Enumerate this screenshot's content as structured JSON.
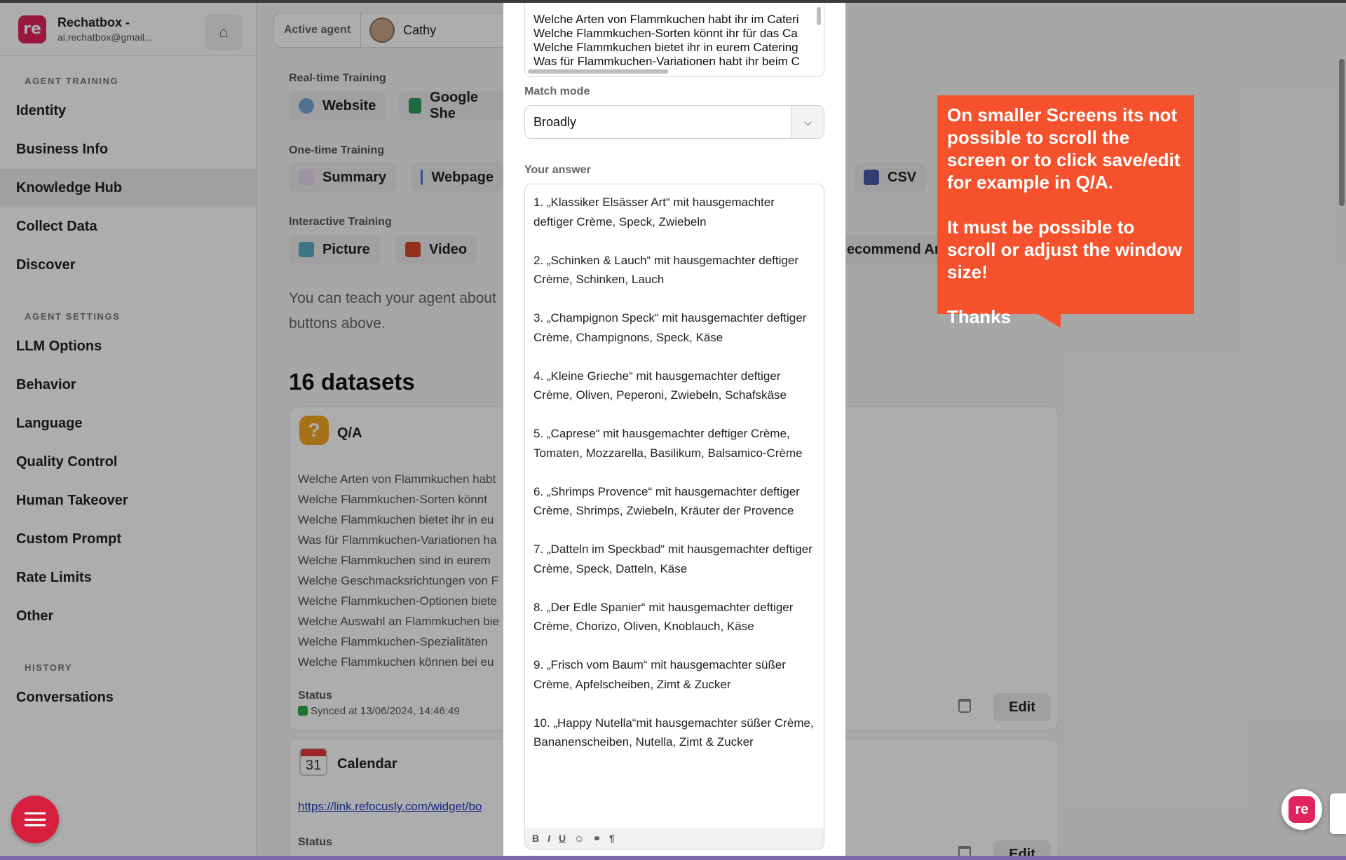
{
  "brand": {
    "name": "Rechatbox -",
    "email": "ai.rechatbox@gmail..."
  },
  "sidebar": {
    "sections": [
      {
        "title": "AGENT TRAINING",
        "items": [
          "Identity",
          "Business Info",
          "Knowledge Hub",
          "Collect Data",
          "Discover"
        ]
      },
      {
        "title": "AGENT SETTINGS",
        "items": [
          "LLM Options",
          "Behavior",
          "Language",
          "Quality Control",
          "Human Takeover",
          "Custom Prompt",
          "Rate Limits",
          "Other"
        ]
      },
      {
        "title": "HISTORY",
        "items": [
          "Conversations"
        ]
      }
    ],
    "active": "Knowledge Hub"
  },
  "header": {
    "active_agent_label": "Active agent",
    "agent_name": "Cathy"
  },
  "training": {
    "realtime_label": "Real-time Training",
    "realtime": [
      "Website",
      "Google She"
    ],
    "onetime_label": "One-time Training",
    "onetime": [
      "Summary",
      "Webpage",
      "CSV"
    ],
    "interactive_label": "Interactive Training",
    "interactive": [
      "Picture",
      "Video",
      "ecommend Art"
    ],
    "teach_text": "You can teach your agent about buttons above."
  },
  "datasets": {
    "count_label": "16 datasets",
    "qa": {
      "title": "Q/A",
      "questions": [
        "Welche Arten von Flammkuchen habt",
        "Welche Flammkuchen-Sorten könnt",
        "Welche Flammkuchen bietet ihr in eu",
        "Was für Flammkuchen-Variationen ha",
        "Welche Flammkuchen sind in eurem",
        "Welche Geschmacksrichtungen von F",
        "Welche Flammkuchen-Optionen biete",
        "Welche Auswahl an Flammkuchen bie",
        "Welche Flammkuchen-Spezialitäten",
        "Welche Flammkuchen können bei eu"
      ],
      "status_label": "Status",
      "status_value": "Synced at 13/06/2024, 14:46:49",
      "edit_label": "Edit"
    },
    "calendar": {
      "title": "Calendar",
      "day": "31",
      "link": "https://link.refocusly.com/widget/bo",
      "status_label": "Status",
      "edit_label": "Edit"
    }
  },
  "modal": {
    "questions": [
      "Welche Arten von Flammkuchen habt ihr im Cateri",
      "Welche Flammkuchen-Sorten könnt ihr für das Ca",
      "Welche Flammkuchen bietet ihr in eurem Catering",
      "Was für Flammkuchen-Variationen habt ihr beim C"
    ],
    "match_mode_label": "Match mode",
    "match_mode_value": "Broadly",
    "answer_label": "Your answer",
    "answer_items": [
      "1. „Klassiker Elsässer Art“ mit hausgemachter deftiger Crème, Speck, Zwiebeln",
      "2. „Schinken & Lauch“ mit hausgemachter deftiger Crème, Schinken, Lauch",
      "3. „Champignon Speck“ mit hausgemachter deftiger Crème, Champignons, Speck, Käse",
      "4. „Kleine Grieche“ mit hausgemachter deftiger Crème, Oliven, Peperoni, Zwiebeln, Schafskäse",
      "5. „Caprese“ mit hausgemachter deftiger Crème, Tomaten, Mozzarella, Basilikum, Balsamico-Crème",
      "6. „Shrimps Provence“ mit hausgemachter deftiger Crème, Shrimps, Zwiebeln, Kräuter der Provence",
      "7. „Datteln im Speckbad“ mit hausgemachter deftiger Crème, Speck, Datteln, Käse",
      "8. „Der Edle Spanier“ mit hausgemachter deftiger Crème, Chorizo, Oliven, Knoblauch, Käse",
      "9. „Frisch vom Baum“ mit hausgemachter süßer Crème, Apfelscheiben, Zimt & Zucker",
      "10. „Happy Nutella“mit hausgemachter süßer Crème, Bananenscheiben, Nutella, Zimt & Zucker"
    ],
    "toolbar": [
      "B",
      "I",
      "U",
      "☺",
      "⚭",
      "¶"
    ]
  },
  "callout": {
    "paragraphs": [
      "On smaller Screens its not possible to scroll the screen or to click save/edit for example in Q/A.",
      "It must be possible to scroll or adjust the window size!",
      "Thanks"
    ],
    "color": "#f4512c"
  },
  "colors": {
    "brand": "#e0245e",
    "accent": "#f4512c"
  }
}
